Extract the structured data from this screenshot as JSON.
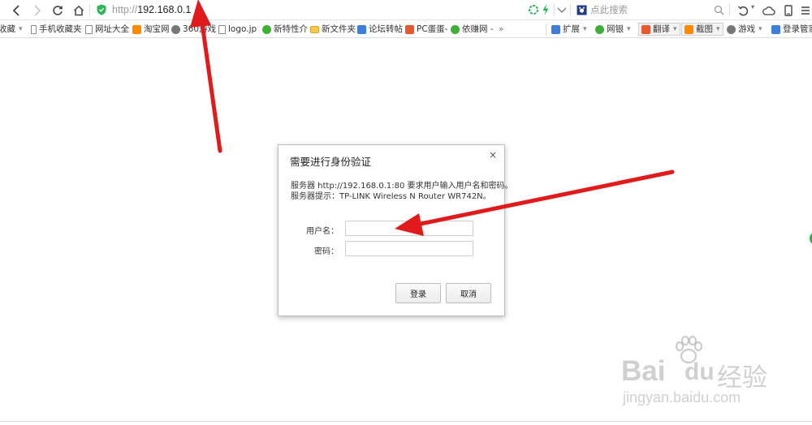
{
  "browser": {
    "url_protocol": "http://",
    "url_host": "192.168.0.1",
    "search_placeholder": "点此搜索"
  },
  "bookmarks": [
    {
      "label": "收藏",
      "icon": "chevron-down-icon"
    },
    {
      "label": "手机收藏夹",
      "icon": "phone-icon"
    },
    {
      "label": "网址大全",
      "icon": "page-icon"
    },
    {
      "label": "淘宝网",
      "icon": "taobao-icon"
    },
    {
      "label": "360游戏",
      "icon": "gamepad-icon"
    },
    {
      "label": "logo.jp",
      "icon": "page-icon"
    },
    {
      "label": "新特性介",
      "icon": "leaf-icon"
    },
    {
      "label": "新文件夹",
      "icon": "folder-icon"
    },
    {
      "label": "论坛转帖",
      "icon": "forum-icon"
    },
    {
      "label": "PC蛋蛋-",
      "icon": "pc-icon"
    },
    {
      "label": "依赚网 -",
      "icon": "earn-icon"
    },
    {
      "label": "»",
      "icon": "overflow-icon"
    }
  ],
  "toolbar_right": [
    {
      "label": "扩展",
      "icon": "extensions-icon"
    },
    {
      "label": "网银",
      "icon": "bank-icon"
    },
    {
      "label": "翻译",
      "icon": "translate-icon"
    },
    {
      "label": "截图",
      "icon": "screenshot-icon"
    },
    {
      "label": "游戏",
      "icon": "game-icon"
    },
    {
      "label": "登录管家",
      "icon": "login-icon"
    }
  ],
  "dialog": {
    "title": "需要进行身份验证",
    "close": "×",
    "message_line1": "服务器 http://192.168.0.1:80 要求用户输入用户名和密码。",
    "message_line2": "服务器提示：TP-LINK Wireless N Router WR742N。",
    "username_label": "用户名：",
    "password_label": "密码：",
    "username_value": "",
    "password_value": "",
    "login_button": "登录",
    "cancel_button": "取消"
  },
  "watermark": {
    "brand": "Bai",
    "brand_suffix": "du",
    "brand_cn": "经验",
    "url": "jingyan.baidu.com"
  },
  "colors": {
    "annotation_arrow": "#e11b1b",
    "security_shield": "#2fb45a"
  }
}
